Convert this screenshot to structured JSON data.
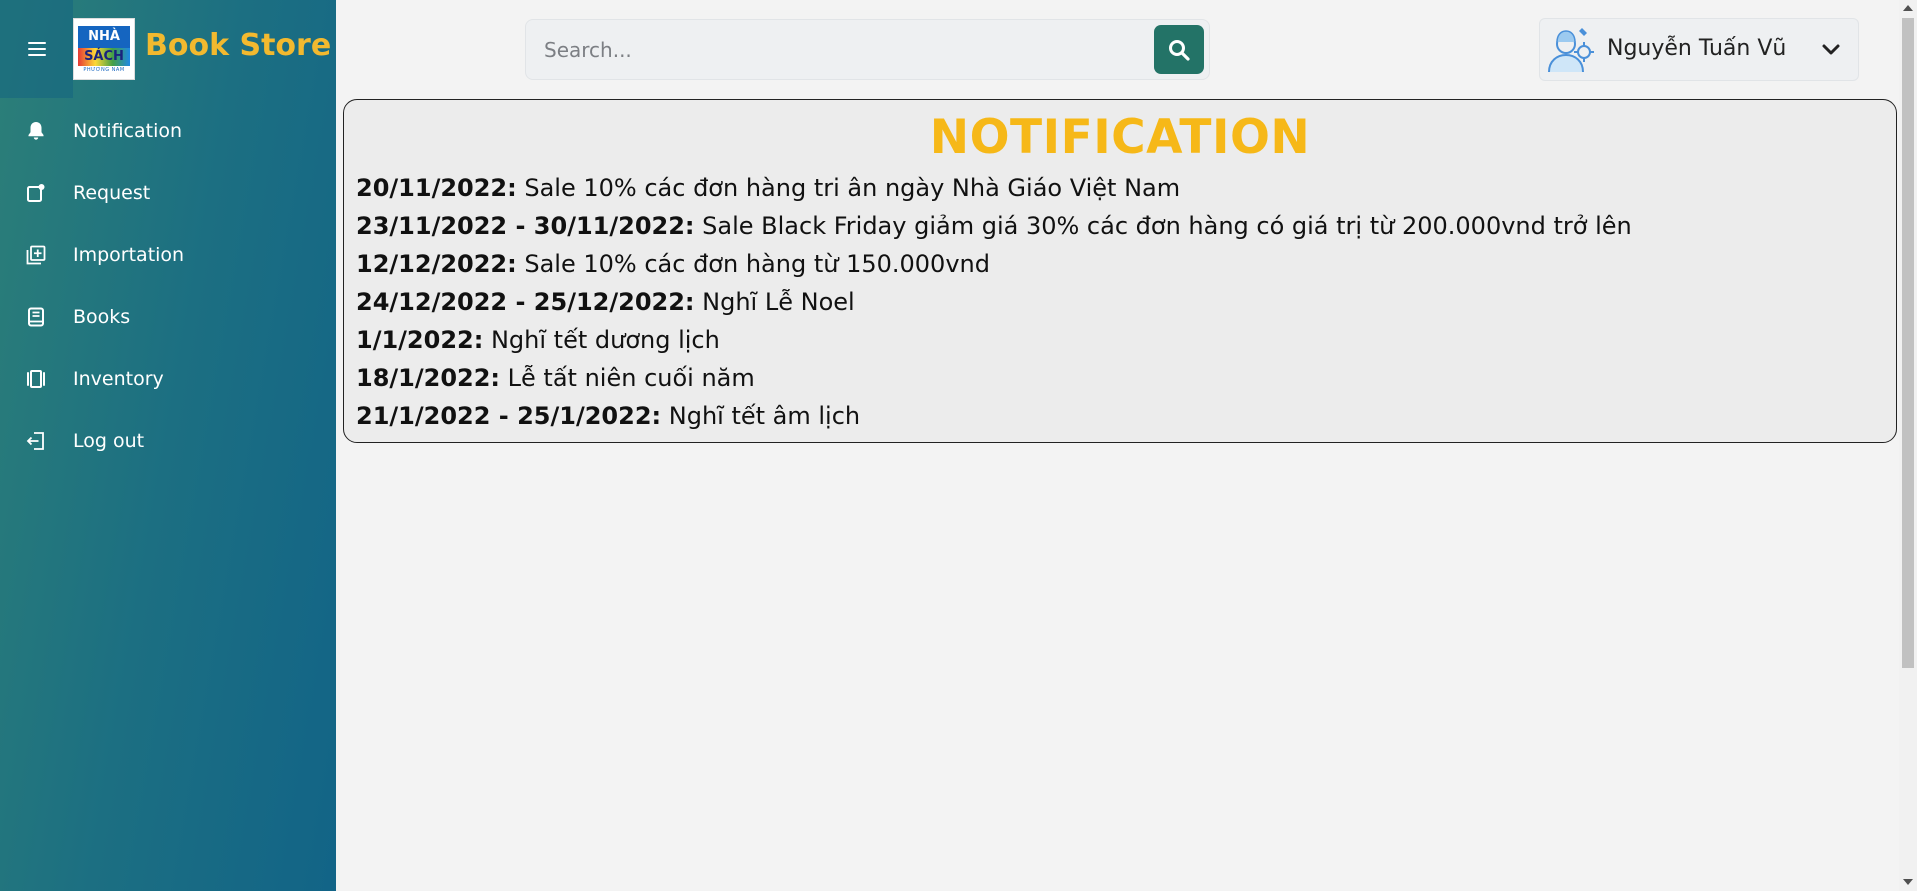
{
  "sidebar": {
    "brand": "Book Store",
    "logo": {
      "line1": "NHÀ",
      "line2": "SÁCH",
      "line3": "PHƯƠNG NAM"
    },
    "items": [
      {
        "label": "Notification",
        "icon": "bell-icon"
      },
      {
        "label": "Request",
        "icon": "request-icon"
      },
      {
        "label": "Importation",
        "icon": "add-box-icon"
      },
      {
        "label": "Books",
        "icon": "book-icon"
      },
      {
        "label": "Inventory",
        "icon": "inventory-icon"
      },
      {
        "label": "Log out",
        "icon": "logout-icon"
      }
    ]
  },
  "header": {
    "search_placeholder": "Search...",
    "user_name": "Nguyễn Tuấn Vũ"
  },
  "notification": {
    "title": "NOTIFICATION",
    "items": [
      {
        "date": "20/11/2022:",
        "text": " Sale 10% các đơn hàng tri ân ngày Nhà Giáo Việt Nam"
      },
      {
        "date": "23/11/2022 - 30/11/2022:",
        "text": " Sale Black Friday giảm giá 30% các đơn hàng có giá trị từ 200.000vnd trở lên"
      },
      {
        "date": "12/12/2022:",
        "text": " Sale 10% các đơn hàng từ 150.000vnd"
      },
      {
        "date": "24/12/2022 - 25/12/2022:",
        "text": " Nghĩ Lễ Noel"
      },
      {
        "date": "1/1/2022:",
        "text": " Nghĩ tết dương lịch"
      },
      {
        "date": "18/1/2022:",
        "text": " Lễ tất niên cuối năm"
      },
      {
        "date": "21/1/2022 - 25/1/2022:",
        "text": " Nghĩ tết âm lịch"
      }
    ]
  },
  "colors": {
    "brand": "#f2b92f",
    "title": "#f6b818",
    "search_button": "#237367",
    "sidebar_start": "#2c7f78",
    "sidebar_end": "#126487"
  }
}
